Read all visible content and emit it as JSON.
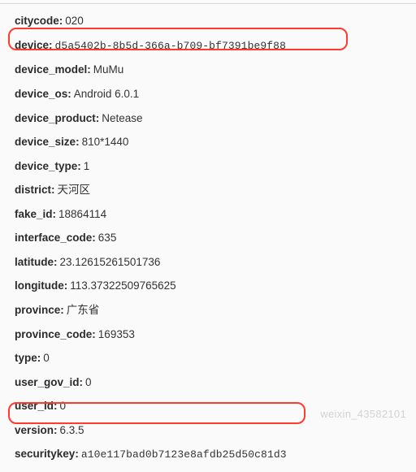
{
  "rows": [
    {
      "key": "citycode",
      "value": "020",
      "mono": false
    },
    {
      "key": "device",
      "value": "d5a5402b-8b5d-366a-b709-bf7391be9f88",
      "mono": true
    },
    {
      "key": "device_model",
      "value": "MuMu",
      "mono": false
    },
    {
      "key": "device_os",
      "value": "Android 6.0.1",
      "mono": false
    },
    {
      "key": "device_product",
      "value": "Netease",
      "mono": false
    },
    {
      "key": "device_size",
      "value": "810*1440",
      "mono": false
    },
    {
      "key": "device_type",
      "value": "1",
      "mono": false
    },
    {
      "key": "district",
      "value": "天河区",
      "mono": false
    },
    {
      "key": "fake_id",
      "value": "18864114",
      "mono": false
    },
    {
      "key": "interface_code",
      "value": "635",
      "mono": false
    },
    {
      "key": "latitude",
      "value": "23.12615261501736",
      "mono": false
    },
    {
      "key": "longitude",
      "value": "113.37322509765625",
      "mono": false
    },
    {
      "key": "province",
      "value": "广东省",
      "mono": false
    },
    {
      "key": "province_code",
      "value": "169353",
      "mono": false
    },
    {
      "key": "type",
      "value": "0",
      "mono": false
    },
    {
      "key": "user_gov_id",
      "value": "0",
      "mono": false
    },
    {
      "key": "user_id",
      "value": "0",
      "mono": false
    },
    {
      "key": "version",
      "value": "6.3.5",
      "mono": false
    },
    {
      "key": "securitykey",
      "value": "a10e117bad0b7123e8afdb25d50c81d3",
      "mono": true
    }
  ],
  "watermark": "weixin_43582101"
}
